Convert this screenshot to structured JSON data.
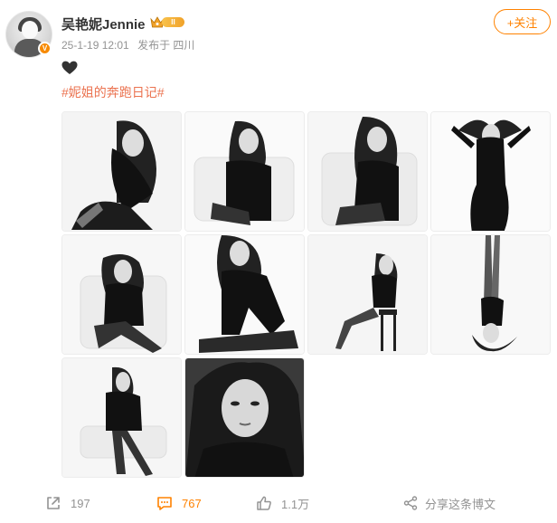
{
  "post": {
    "author": "吴艳妮Jennie",
    "verified_badge": "V",
    "level_badge": "II",
    "timestamp": "25-1-19 12:01",
    "source": "发布于 四川",
    "follow_label": "+关注",
    "emoji": "black-heart",
    "topic": "#妮姐的奔跑日记#",
    "images": [
      {
        "name": "photo-1",
        "alt": ""
      },
      {
        "name": "photo-2",
        "alt": ""
      },
      {
        "name": "photo-3",
        "alt": ""
      },
      {
        "name": "photo-4",
        "alt": ""
      },
      {
        "name": "photo-5",
        "alt": ""
      },
      {
        "name": "photo-6",
        "alt": ""
      },
      {
        "name": "photo-7",
        "alt": ""
      },
      {
        "name": "photo-8",
        "alt": ""
      },
      {
        "name": "photo-9",
        "alt": ""
      },
      {
        "name": "photo-10",
        "alt": ""
      }
    ]
  },
  "actions": {
    "share_count": "197",
    "comment_count": "767",
    "like_count": "1.1万",
    "share_post_label": "分享这条博文"
  },
  "colors": {
    "accent": "#ff8200",
    "topic": "#eb7350",
    "muted": "#939393"
  }
}
